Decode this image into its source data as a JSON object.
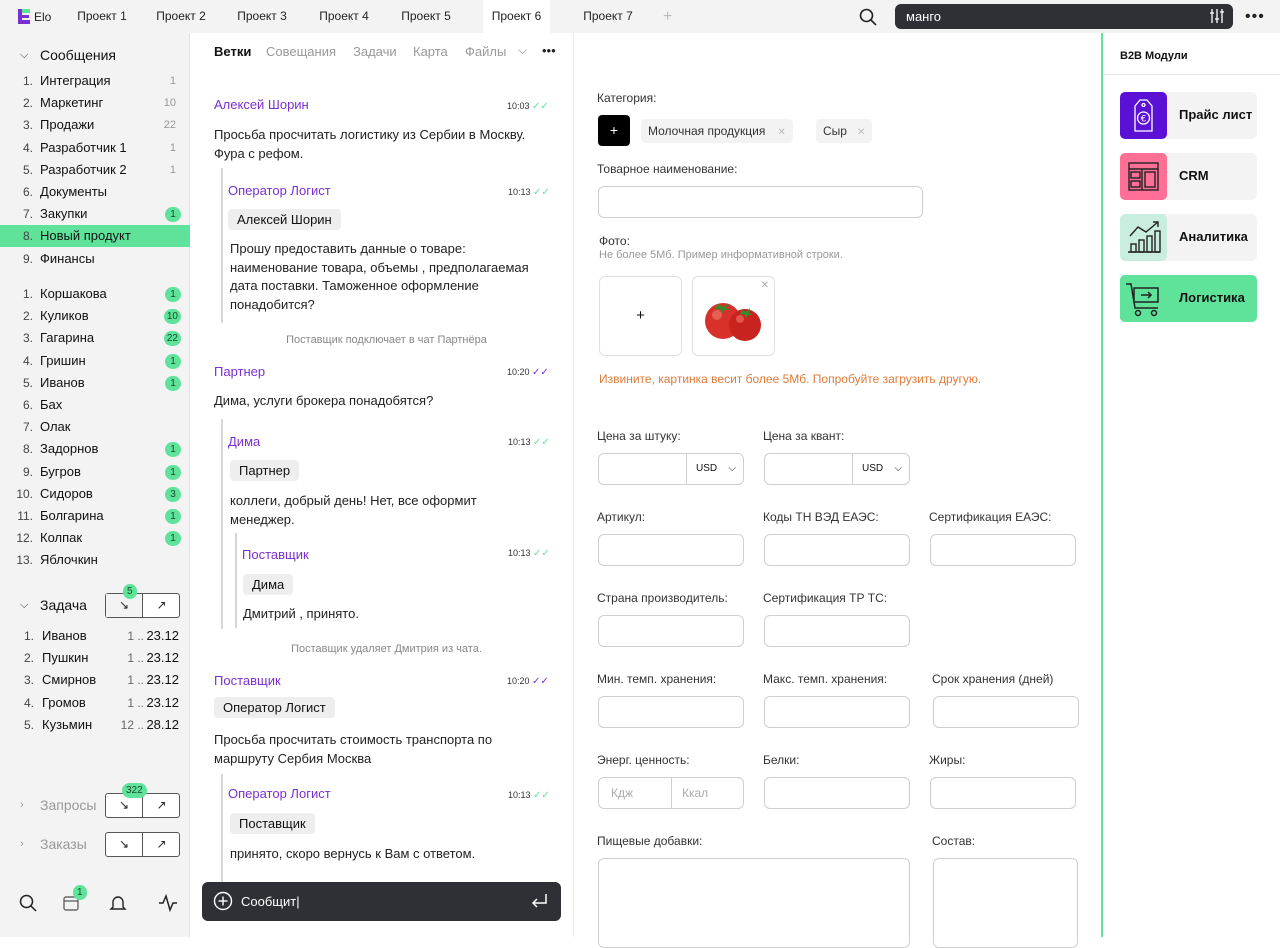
{
  "app": {
    "name": "Elo"
  },
  "tabs": [
    {
      "label": "Проект 1"
    },
    {
      "label": "Проект 2"
    },
    {
      "label": "Проект 3"
    },
    {
      "label": "Проект 4"
    },
    {
      "label": "Проект 5"
    },
    {
      "label": "Проект 6"
    },
    {
      "label": "Проект 7"
    }
  ],
  "active_tab": "Проект 6",
  "search": {
    "value": "манго"
  },
  "sidebar": {
    "messages_title": "Сообщения",
    "channels": [
      {
        "num": "1.",
        "label": "Интеграция",
        "count": "1"
      },
      {
        "num": "2.",
        "label": "Маркетинг",
        "count": "10"
      },
      {
        "num": "3.",
        "label": "Продажи",
        "count": "22"
      },
      {
        "num": "4.",
        "label": "Разработчик 1",
        "count": "1"
      },
      {
        "num": "5.",
        "label": "Разработчик 2",
        "count": "1"
      },
      {
        "num": "6.",
        "label": "Документы",
        "count": ""
      },
      {
        "num": "7.",
        "label": "Закупки",
        "badge": "1"
      },
      {
        "num": "8.",
        "label": "Новый продукт",
        "count": ""
      },
      {
        "num": "9.",
        "label": "Финансы",
        "count": ""
      }
    ],
    "people": [
      {
        "num": "1.",
        "label": "Коршакова",
        "badge": "1"
      },
      {
        "num": "2.",
        "label": "Куликов",
        "badge": "10"
      },
      {
        "num": "3.",
        "label": "Гагарина",
        "badge": "22"
      },
      {
        "num": "4.",
        "label": "Гришин",
        "badge": "1"
      },
      {
        "num": "5.",
        "label": "Иванов",
        "badge": "1"
      },
      {
        "num": "6.",
        "label": "Бах",
        "badge": ""
      },
      {
        "num": "7.",
        "label": "Олак",
        "badge": ""
      },
      {
        "num": "8.",
        "label": "Задорнов",
        "badge": "1"
      },
      {
        "num": "9.",
        "label": "Бугров",
        "badge": "1"
      },
      {
        "num": "10.",
        "label": "Сидоров",
        "badge": "3"
      },
      {
        "num": "11.",
        "label": "Болгарина",
        "badge": "1"
      },
      {
        "num": "12.",
        "label": "Колпак",
        "badge": "1"
      },
      {
        "num": "13.",
        "label": "Яблочкин",
        "badge": ""
      }
    ],
    "task_title": "Задача",
    "task_badge": "5",
    "tasks": [
      {
        "num": "1.",
        "name": "Иванов",
        "mid": "1 ..",
        "date": "23.12"
      },
      {
        "num": "2.",
        "name": "Пушкин",
        "mid": "1 ..",
        "date": "23.12"
      },
      {
        "num": "3.",
        "name": "Смирнов",
        "mid": "1 ..",
        "date": "23.12"
      },
      {
        "num": "4.",
        "name": "Громов",
        "mid": "1 ..",
        "date": "23.12"
      },
      {
        "num": "5.",
        "name": "Кузьмин",
        "mid": "12 ..",
        "date": "28.12"
      }
    ],
    "requests_title": "Запросы",
    "requests_badge": "322",
    "orders_title": "Заказы",
    "bottom_badge": "1"
  },
  "chat": {
    "tabs": [
      "Ветки",
      "Совещания",
      "Задачи",
      "Карта",
      "Файлы"
    ],
    "messages": {
      "m1_author": "Алексей Шорин",
      "m1_time": "10:03",
      "m1_text": "Просьба просчитать логистику из Сербии в Москву. Фура с рефом.",
      "m1r_author": "Оператор Логист",
      "m1r_time": "10:13",
      "m1r_chip": "Алексей Шорин",
      "m1r_text": "Прошу предоставить данные о товаре: наименование товара, объемы , предполагаемая дата поставки. Таможенное оформление понадобится?",
      "sys1": "Поставщик подключает в чат Партнёра",
      "m2_author": "Партнер",
      "m2_time": "10:20",
      "m2_text": "Дима, услуги брокера понадобятся?",
      "m2r_author": "Дима",
      "m2r_time": "10:13",
      "m2r_chip": "Партнер",
      "m2r_text": "коллеги, добрый день! Нет, все оформит менеджер.",
      "m2rr_author": "Поставщик",
      "m2rr_time": "10:13",
      "m2rr_chip": "Дима",
      "m2rr_text": "Дмитрий , принято.",
      "sys2": "Поставщик удаляет Дмитрия из чата.",
      "m3_author": "Поставщик",
      "m3_time": "10:20",
      "m3_chip": "Оператор Логист",
      "m3_text": "Просьба просчитать стоимость транспорта по маршруту Сербия Москва",
      "m3r_author": "Оператор Логист",
      "m3r_time": "10:13",
      "m3r_chip": "Поставщик",
      "m3r_text": "принято, скоро вернусь к Вам с ответом."
    },
    "compose_value": "Сообщит|"
  },
  "form": {
    "category_label": "Категория:",
    "categories": [
      "Молочная продукция",
      "Сыр"
    ],
    "name_label": "Товарное наименование:",
    "photo_label": "Фото:",
    "photo_hint": "Не более 5Мб. Пример информативной строки.",
    "photo_error": "Извините, картинка весит более 5Мб. Попробуйте загрузить другую.",
    "price_unit_label": "Цена за штуку:",
    "price_quant_label": "Цена за квант:",
    "currency": "USD",
    "article_label": "Артикул:",
    "codes_label": "Коды ТН ВЭД ЕАЭС:",
    "cert_eaes_label": "Сертификация ЕАЭС:",
    "country_label": "Страна производитель:",
    "cert_tr_label": "Сертификация ТР ТС:",
    "min_temp_label": "Мин. темп. хранения:",
    "max_temp_label": "Макс. темп. хранения:",
    "shelf_label": "Срок хранения (дней)",
    "energy_label": "Энерг. ценность:",
    "kj_placeholder": "Кдж",
    "kcal_placeholder": "Ккал",
    "protein_label": "Белки:",
    "fat_label": "Жиры:",
    "additives_label": "Пищевые добавки:",
    "composition_label": "Состав:"
  },
  "modules": {
    "title": "B2B Модули",
    "items": [
      {
        "label": "Прайс лист",
        "color": "#5b10d6"
      },
      {
        "label": "CRM",
        "color": "#ff6f96"
      },
      {
        "label": "Аналитика",
        "color": "#c9eee0"
      },
      {
        "label": "Логистика",
        "color": "#5fe39a"
      }
    ]
  }
}
